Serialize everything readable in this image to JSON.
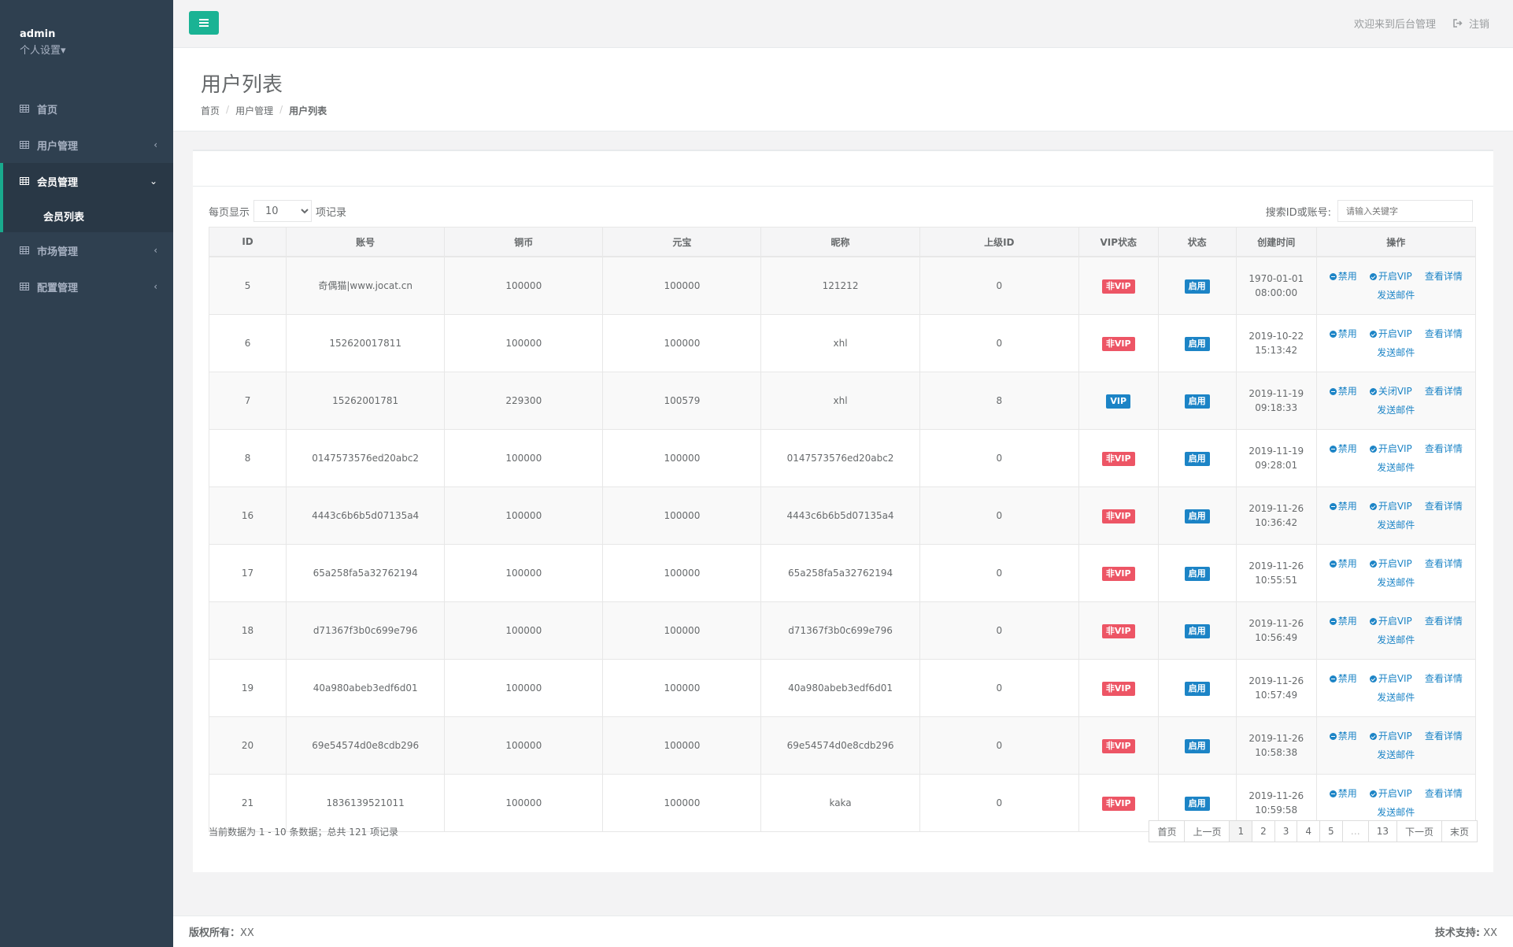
{
  "sidebar": {
    "user": "admin",
    "settings": "个人设置",
    "items": [
      {
        "label": "首页"
      },
      {
        "label": "用户管理"
      },
      {
        "label": "会员管理"
      },
      {
        "label": "市场管理"
      },
      {
        "label": "配置管理"
      }
    ],
    "sub_items": [
      {
        "label": "会员列表"
      }
    ]
  },
  "topbar": {
    "welcome": "欢迎来到后台管理",
    "logout": "注销"
  },
  "heading": {
    "title": "用户列表",
    "breadcrumb": [
      "首页",
      "用户管理",
      "用户列表"
    ]
  },
  "toolbar": {
    "per_page_prefix": "每页显示",
    "per_page_value": "10",
    "per_page_suffix": "项记录",
    "search_label": "搜索ID或账号:",
    "search_placeholder": "请输入关键字"
  },
  "table": {
    "columns": [
      "ID",
      "账号",
      "铜币",
      "元宝",
      "昵称",
      "上级ID",
      "VIP状态",
      "状态",
      "创建时间",
      "操作"
    ],
    "rows": [
      {
        "id": "5",
        "account": "奇偶猫|www.jocat.cn",
        "copper": "100000",
        "gold": "100000",
        "nick": "121212",
        "parent": "0",
        "vip": "非VIP",
        "status": "启用",
        "date": "1970-01-01",
        "time": "08:00:00",
        "vip_action": "开启VIP"
      },
      {
        "id": "6",
        "account": "152620017811",
        "copper": "100000",
        "gold": "100000",
        "nick": "xhl",
        "parent": "0",
        "vip": "非VIP",
        "status": "启用",
        "date": "2019-10-22",
        "time": "15:13:42",
        "vip_action": "开启VIP"
      },
      {
        "id": "7",
        "account": "15262001781",
        "copper": "229300",
        "gold": "100579",
        "nick": "xhl",
        "parent": "8",
        "vip": "VIP",
        "status": "启用",
        "date": "2019-11-19",
        "time": "09:18:33",
        "vip_action": "关闭VIP"
      },
      {
        "id": "8",
        "account": "0147573576ed20abc2",
        "copper": "100000",
        "gold": "100000",
        "nick": "0147573576ed20abc2",
        "parent": "0",
        "vip": "非VIP",
        "status": "启用",
        "date": "2019-11-19",
        "time": "09:28:01",
        "vip_action": "开启VIP"
      },
      {
        "id": "16",
        "account": "4443c6b6b5d07135a4",
        "copper": "100000",
        "gold": "100000",
        "nick": "4443c6b6b5d07135a4",
        "parent": "0",
        "vip": "非VIP",
        "status": "启用",
        "date": "2019-11-26",
        "time": "10:36:42",
        "vip_action": "开启VIP"
      },
      {
        "id": "17",
        "account": "65a258fa5a32762194",
        "copper": "100000",
        "gold": "100000",
        "nick": "65a258fa5a32762194",
        "parent": "0",
        "vip": "非VIP",
        "status": "启用",
        "date": "2019-11-26",
        "time": "10:55:51",
        "vip_action": "开启VIP"
      },
      {
        "id": "18",
        "account": "d71367f3b0c699e796",
        "copper": "100000",
        "gold": "100000",
        "nick": "d71367f3b0c699e796",
        "parent": "0",
        "vip": "非VIP",
        "status": "启用",
        "date": "2019-11-26",
        "time": "10:56:49",
        "vip_action": "开启VIP"
      },
      {
        "id": "19",
        "account": "40a980abeb3edf6d01",
        "copper": "100000",
        "gold": "100000",
        "nick": "40a980abeb3edf6d01",
        "parent": "0",
        "vip": "非VIP",
        "status": "启用",
        "date": "2019-11-26",
        "time": "10:57:49",
        "vip_action": "开启VIP"
      },
      {
        "id": "20",
        "account": "69e54574d0e8cdb296",
        "copper": "100000",
        "gold": "100000",
        "nick": "69e54574d0e8cdb296",
        "parent": "0",
        "vip": "非VIP",
        "status": "启用",
        "date": "2019-11-26",
        "time": "10:58:38",
        "vip_action": "开启VIP"
      },
      {
        "id": "21",
        "account": "1836139521011",
        "copper": "100000",
        "gold": "100000",
        "nick": "kaka",
        "parent": "0",
        "vip": "非VIP",
        "status": "启用",
        "date": "2019-11-26",
        "time": "10:59:58",
        "vip_action": "开启VIP"
      }
    ],
    "actions": {
      "ban": "禁用",
      "details": "查看详情",
      "mail": "发送邮件"
    }
  },
  "info": "当前数据为 1 - 10 条数据；总共 121 项记录",
  "pager": [
    "首页",
    "上一页",
    "1",
    "2",
    "3",
    "4",
    "5",
    "…",
    "13",
    "下一页",
    "末页"
  ],
  "footer": {
    "left_label": "版权所有：",
    "left_value": "XX",
    "right_label": "技术支持:",
    "right_value": "XX"
  },
  "colors": {
    "accent": "#1ab394",
    "sidebar": "#2f4050",
    "danger": "#ed5565",
    "primary": "#1c84c6"
  }
}
